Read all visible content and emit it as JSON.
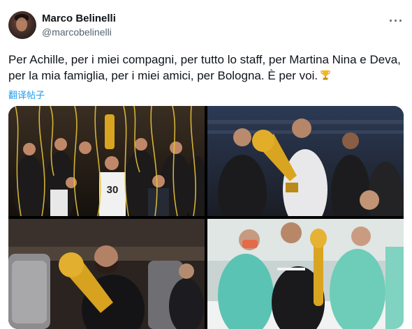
{
  "author": {
    "display_name": "Marco Belinelli",
    "handle": "@marcobelinelli",
    "avatar_icon": "profile-avatar"
  },
  "more_icon": "more-horizontal-icon",
  "tweet": {
    "text": "Per Achille, per i miei compagni, per tutto lo staff, per Martina Nina e Deva, per la mia famiglia, per i miei amici, per Bologna. È per voi.",
    "emoji": "trophy-emoji",
    "translate_label": "翻译帖子"
  },
  "media": {
    "photos": [
      {
        "name": "photo-team-celebration",
        "jersey_number": "30"
      },
      {
        "name": "photo-trophy-kiss-court"
      },
      {
        "name": "photo-trophy-bus"
      },
      {
        "name": "photo-hospital-pointing"
      }
    ]
  },
  "colors": {
    "link": "#1d9bf0",
    "text": "#0f1419",
    "secondary": "#536471",
    "gold": "#d9a521"
  }
}
